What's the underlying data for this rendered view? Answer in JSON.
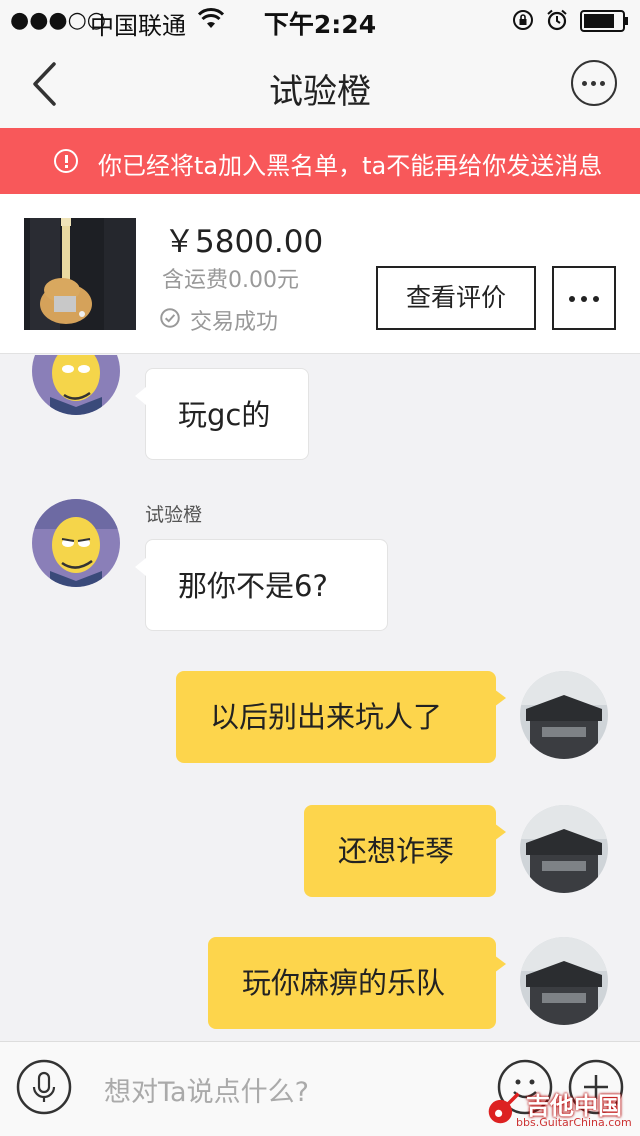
{
  "status_bar": {
    "signal": "●●●○○",
    "carrier": "中国联通",
    "time": "下午2:24"
  },
  "nav": {
    "title": "试验橙"
  },
  "warning": {
    "text": "你已经将ta加入黑名单，ta不能再给你发送消息"
  },
  "product": {
    "price": "￥5800.00",
    "shipping": "含运费0.00元",
    "status": "交易成功",
    "review_button": "查看评价"
  },
  "messages": [
    {
      "side": "in",
      "text": "玩gc的"
    },
    {
      "side": "in",
      "sender": "试验橙",
      "text": "那你不是6?"
    },
    {
      "side": "out",
      "text": "以后别出来坑人了"
    },
    {
      "side": "out",
      "text": "还想诈琴"
    },
    {
      "side": "out",
      "text": "玩你麻痹的乐队"
    }
  ],
  "input": {
    "placeholder": "想对Ta说点什么?"
  },
  "watermark": {
    "title": "吉他中国",
    "subtitle": "bbs.GuitarChina.com"
  },
  "colors": {
    "warning_bg": "#f8585a",
    "outgoing_bubble": "#fdd54c",
    "incoming_bubble": "#ffffff",
    "chat_bg": "#f2f2f4"
  }
}
